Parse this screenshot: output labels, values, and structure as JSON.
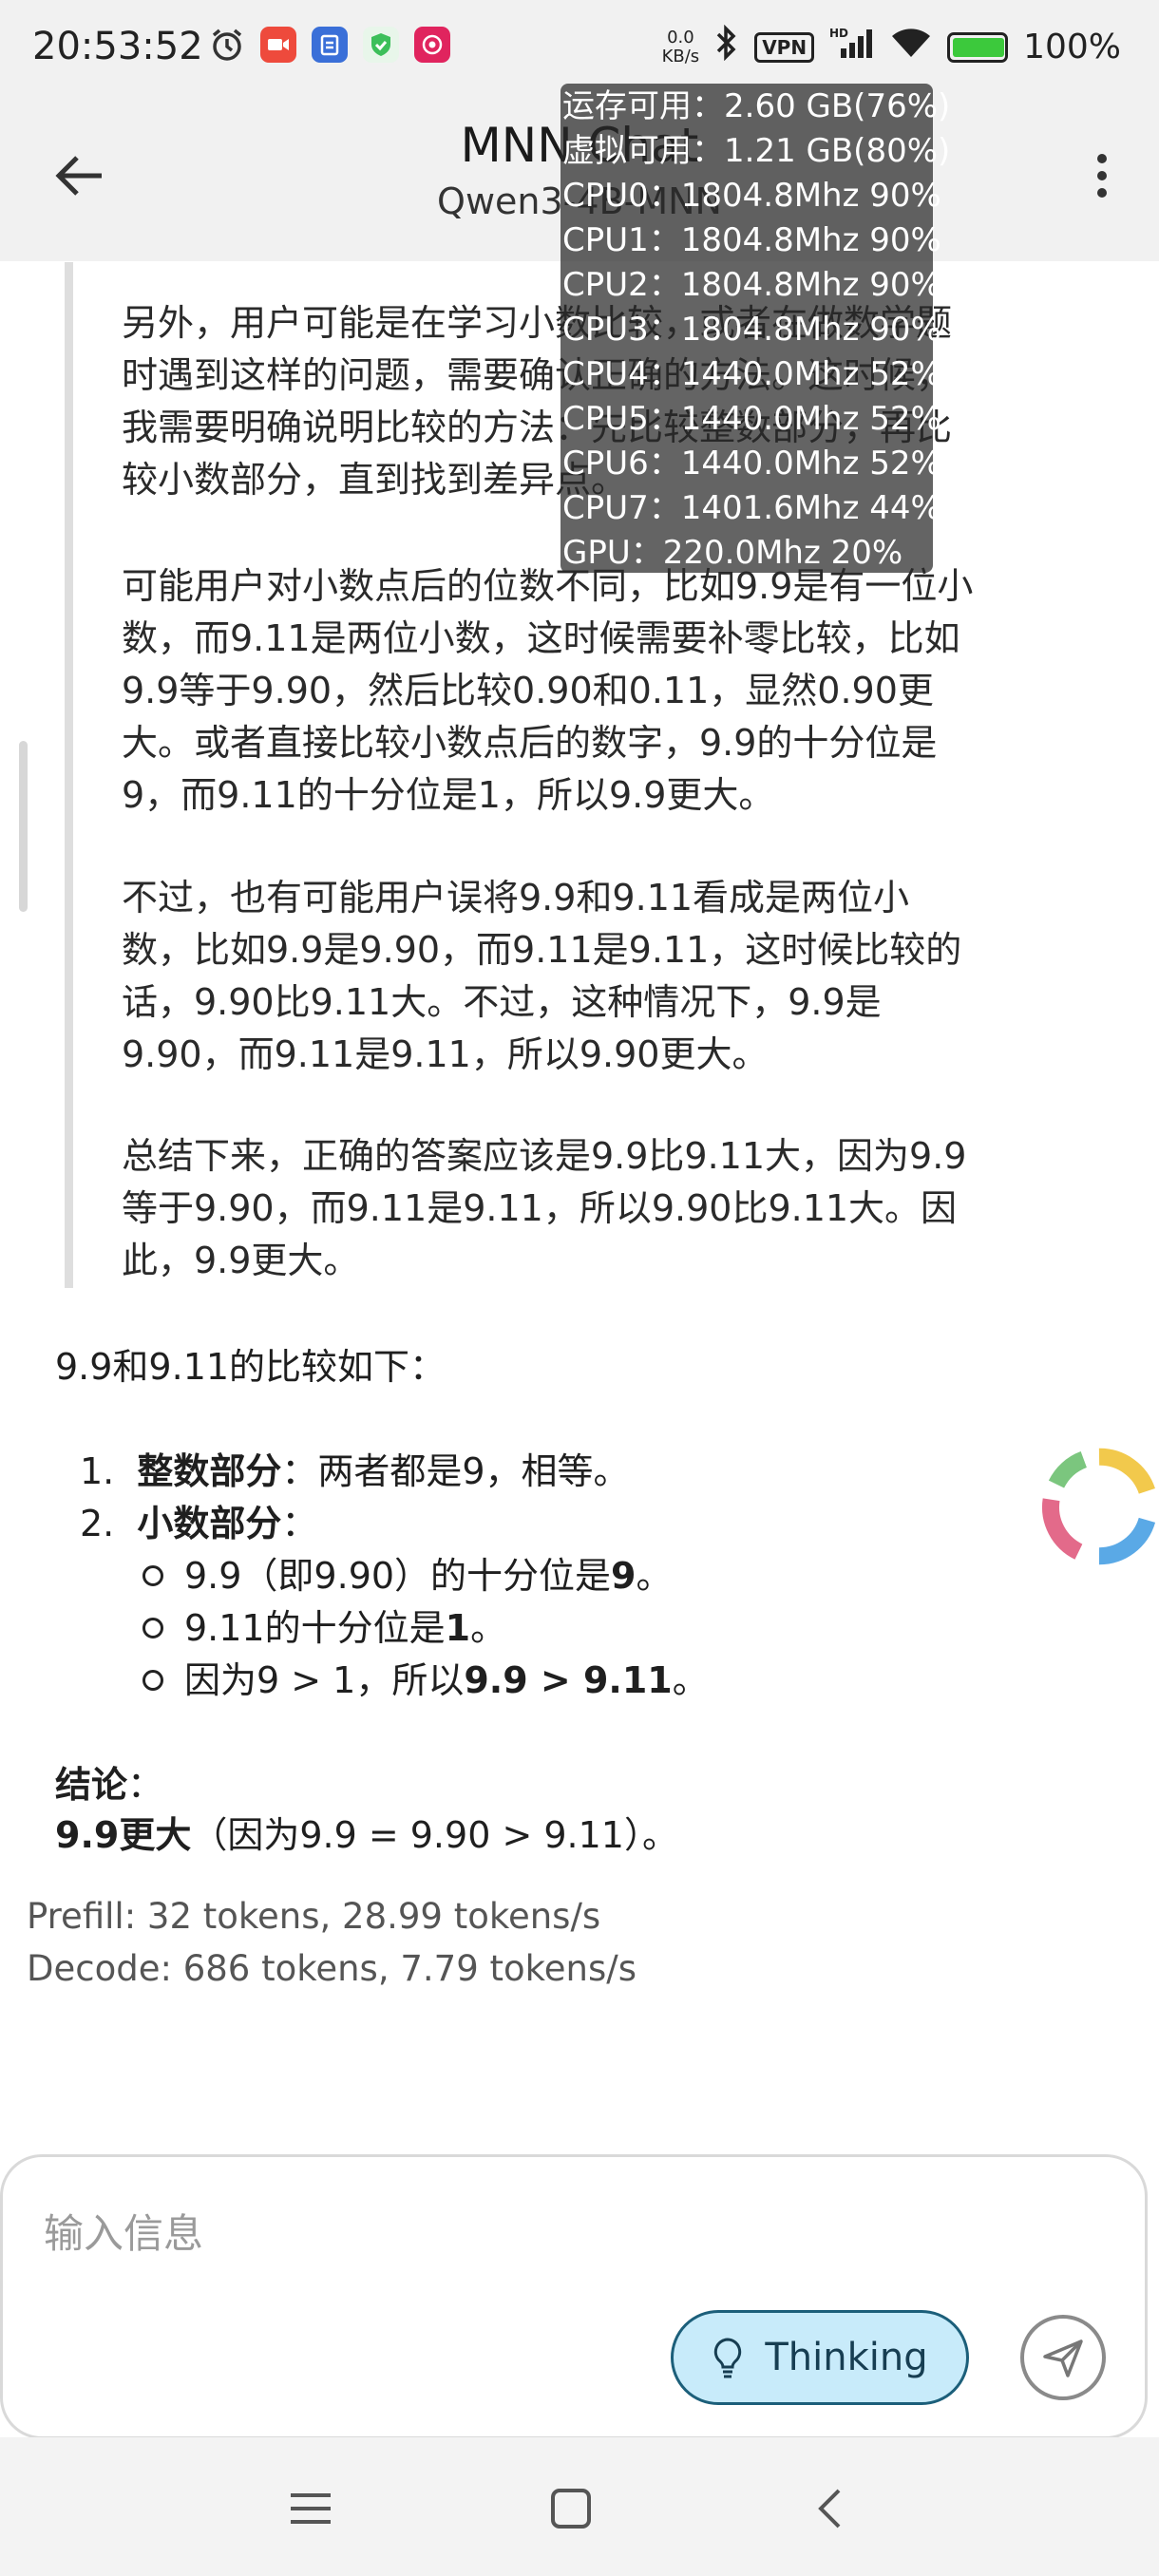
{
  "status_bar": {
    "time": "20:53:52",
    "net_speed_top": "0.0",
    "net_speed_bottom": "KB/s",
    "vpn": "VPN",
    "battery": "100%"
  },
  "app_bar": {
    "title": "MNN Chat",
    "subtitle": "Qwen3-4B-MNN"
  },
  "thinking": {
    "paragraphs": [
      "另外，用户可能是在学习小数比较，或者在做数学题时遇到这样的问题，需要确认正确的方法。这时候，我需要明确说明比较的方法：先比较整数部分，再比较小数部分，直到找到差异点。",
      "可能用户对小数点后的位数不同，比如9.9是有一位小数，而9.11是两位小数，这时候需要补零比较，比如9.9等于9.90，然后比较0.90和0.11，显然0.90更大。或者直接比较小数点后的数字，9.9的十分位是9，而9.11的十分位是1，所以9.9更大。",
      "不过，也有可能用户误将9.9和9.11看成是两位小数，比如9.9是9.90，而9.11是9.11，这时候比较的话，9.90比9.11大。不过，这种情况下，9.9是9.90，而9.11是9.11，所以9.90更大。",
      "总结下来，正确的答案应该是9.9比9.11大，因为9.9等于9.90，而9.11是9.11，所以9.90比9.11大。因此，9.9更大。"
    ]
  },
  "answer": {
    "intro": "9.9和9.11的比较如下：",
    "item1_num": "1.",
    "item1_bold": "整数部分",
    "item1_text": "：两者都是9，相等。",
    "item2_num": "2.",
    "item2_bold": "小数部分",
    "item2_text": "：",
    "sub1_text": "9.9（即9.90）的十分位是",
    "sub1_bold": "9",
    "sub1_end": "。",
    "sub2_text": "9.11的十分位是",
    "sub2_bold": "1",
    "sub2_end": "。",
    "sub3_text": "因为9 > 1，所以",
    "sub3_bold": "9.9 > 9.11",
    "sub3_end": "。",
    "conclusion_label": "结论",
    "conclusion_colon": "：",
    "conclusion_bold": "9.9更大",
    "conclusion_text": "（因为9.9 = 9.90 > 9.11）。"
  },
  "stats": {
    "prefill": "Prefill: 32 tokens, 28.99 tokens/s",
    "decode": "Decode: 686 tokens, 7.79 tokens/s"
  },
  "system_monitor": {
    "lines": [
      "运存可用：2.60 GB(76%)",
      "虚拟可用：1.21 GB(80%)",
      "CPU0：1804.8Mhz 90%",
      "CPU1：1804.8Mhz 90%",
      "CPU2：1804.8Mhz 90%",
      "CPU3：1804.8Mhz 90%",
      "CPU4：1440.0Mhz 52%",
      "CPU5：1440.0Mhz 52%",
      "CPU6：1440.0Mhz 52%",
      "CPU7：1401.6Mhz 44%",
      "GPU：220.0Mhz 20%"
    ]
  },
  "input": {
    "placeholder": "输入信息",
    "thinking_label": "Thinking"
  },
  "colors": {
    "thinking_bg": "#c8ebfa",
    "thinking_border": "#1c5f7a",
    "overlay_bg": "#282828"
  }
}
